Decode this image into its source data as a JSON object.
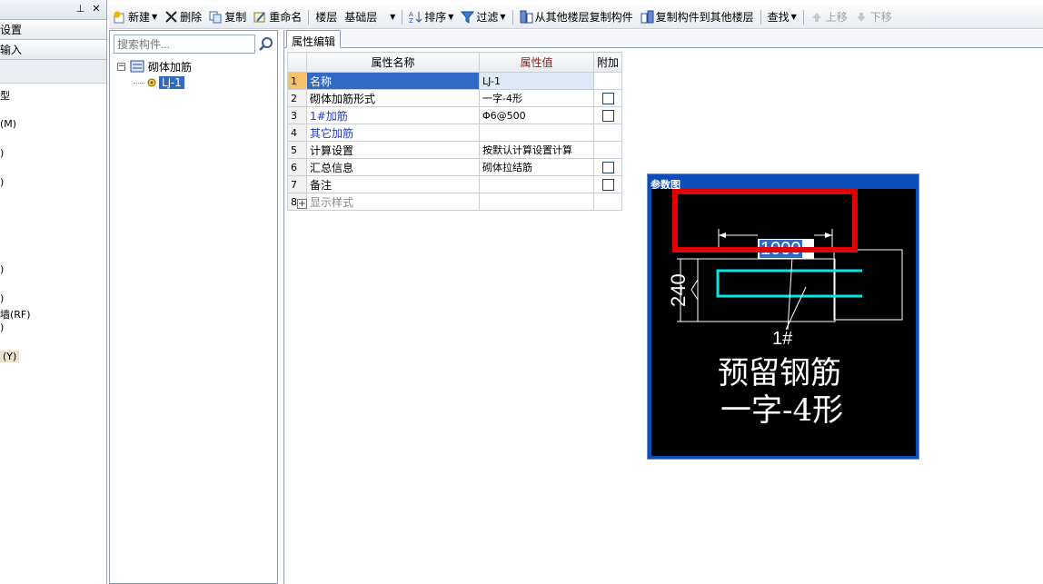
{
  "left_panel": {
    "pin_icon": "⊥",
    "close_icon": "✕",
    "row1": "设置",
    "row2": "输入",
    "items": [
      "型",
      "(M)",
      ")",
      ")",
      ")",
      ")",
      "墙(RF)",
      ")",
      "(Y)"
    ]
  },
  "toolbar": {
    "new_label": "新建",
    "delete_label": "删除",
    "copy_label": "复制",
    "rename_label": "重命名",
    "floor_label": "楼层",
    "floor_value": "基础层",
    "sort_label": "排序",
    "filter_label": "过滤",
    "copy_from_label": "从其他楼层复制构件",
    "copy_to_label": "复制构件到其他楼层",
    "find_label": "查找",
    "move_up_label": "上移",
    "move_down_label": "下移"
  },
  "tree": {
    "search_placeholder": "搜索构件...",
    "root_label": "砌体加筋",
    "child_label": "LJ-1"
  },
  "properties": {
    "tab_label": "属性编辑",
    "headers": {
      "name": "属性名称",
      "value": "属性值",
      "extra": "附加"
    },
    "rows": [
      {
        "num": "1",
        "name": "名称",
        "value": "LJ-1"
      },
      {
        "num": "2",
        "name": "砌体加筋形式",
        "value": "一字-4形"
      },
      {
        "num": "3",
        "name": "1#加筋",
        "value": "Φ6@500"
      },
      {
        "num": "4",
        "name": "其它加筋",
        "value": ""
      },
      {
        "num": "5",
        "name": "计算设置",
        "value": "按默认计算设置计算"
      },
      {
        "num": "6",
        "name": "汇总信息",
        "value": "砌体拉结筋"
      },
      {
        "num": "7",
        "name": "备注",
        "value": ""
      },
      {
        "num": "8",
        "name": "显示样式",
        "value": ""
      }
    ]
  },
  "ref_diagram": {
    "title": "参数图",
    "dimension_value": "1000",
    "wall_thickness": "240",
    "bar_label": "1#",
    "caption_line1": "预留钢筋",
    "caption_line2": "一字-4形",
    "line_color": "#ffffff",
    "rebar_color": "#00e5e5",
    "highlight_color": "#e00000"
  }
}
